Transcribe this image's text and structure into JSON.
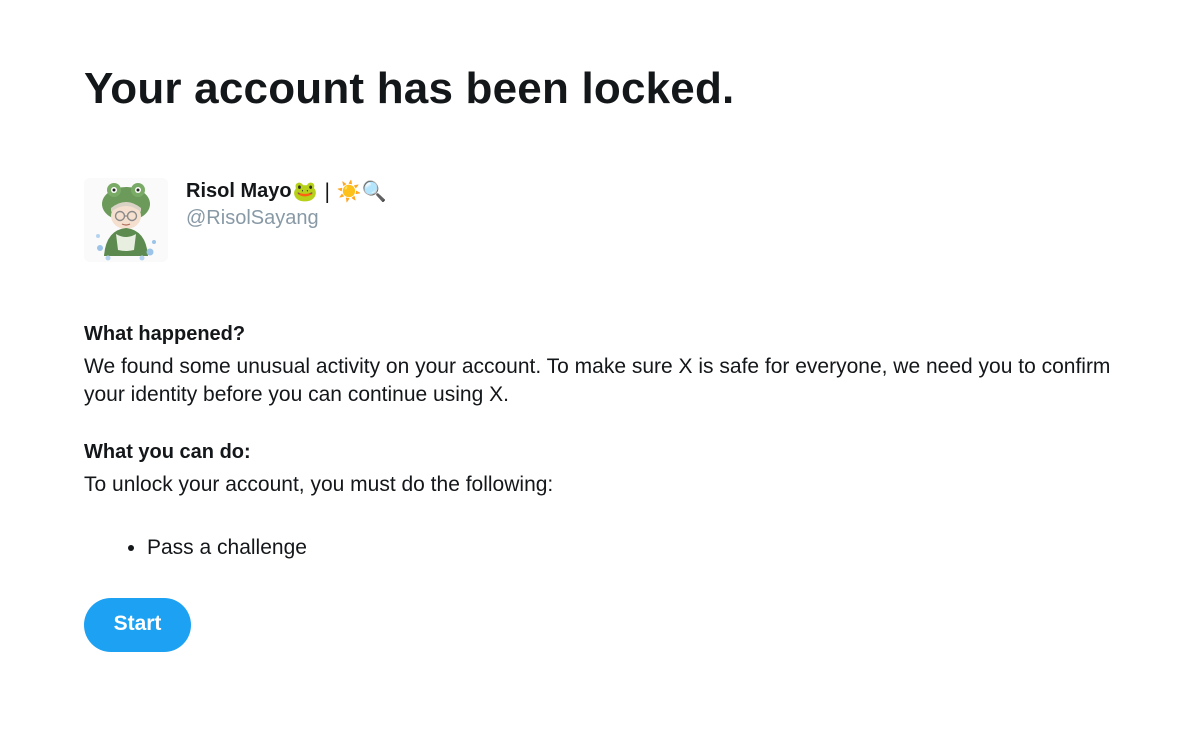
{
  "page": {
    "title": "Your account has been locked."
  },
  "profile": {
    "display_name": "Risol Mayo",
    "name_emojis": "🐸 | ☀️🔍",
    "handle": "@RisolSayang",
    "avatar_icon": "frog-hat-girl-avatar"
  },
  "what_happened": {
    "heading": "What happened?",
    "body": "We found some unusual activity on your account. To make sure X is safe for everyone, we need you to confirm your identity before you can continue using X."
  },
  "what_you_can_do": {
    "heading": "What you can do:",
    "body": "To unlock your account, you must do the following:",
    "steps": [
      "Pass a challenge"
    ]
  },
  "actions": {
    "start_label": "Start"
  },
  "colors": {
    "accent": "#1da1f2",
    "text": "#14171a",
    "secondary_text": "#8899a6"
  }
}
